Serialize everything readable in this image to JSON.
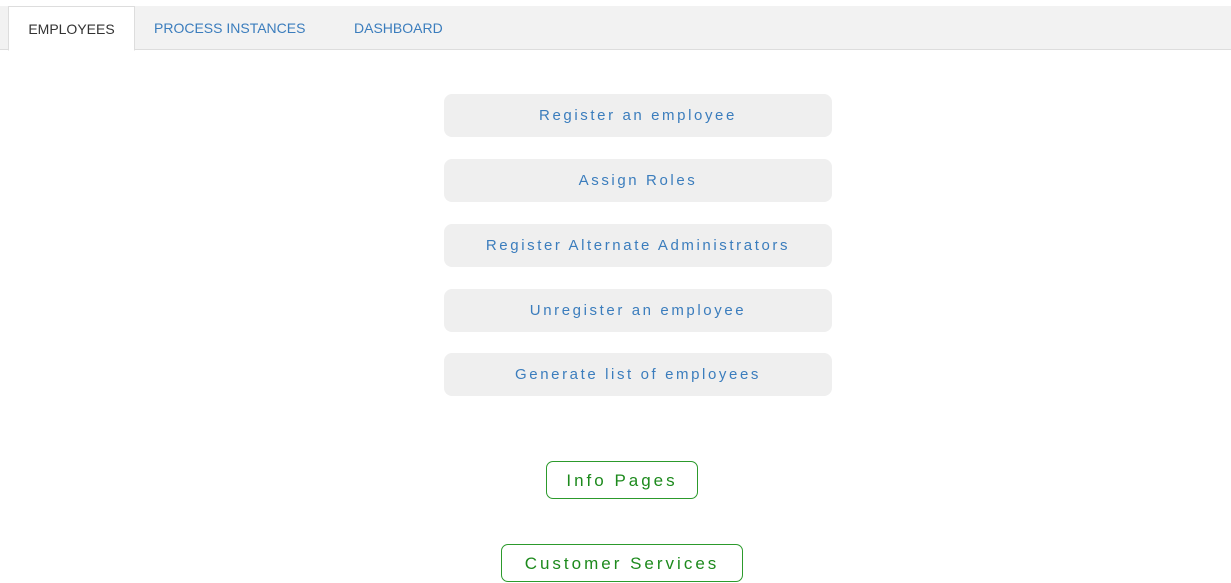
{
  "tabs": [
    {
      "label": "EMPLOYEES",
      "active": true
    },
    {
      "label": "PROCESS INSTANCES",
      "active": false
    },
    {
      "label": "DASHBOARD",
      "active": false
    }
  ],
  "actions": [
    {
      "label": "Register an employee"
    },
    {
      "label": "Assign Roles"
    },
    {
      "label": "Register Alternate Administrators"
    },
    {
      "label": "Unregister an employee"
    },
    {
      "label": "Generate list of employees"
    }
  ],
  "links": {
    "info_pages": "Info Pages",
    "customer_services": "Customer Services"
  },
  "colors": {
    "link_blue": "#3b7dbd",
    "button_bg": "#efefef",
    "green": "#2c9a2c"
  }
}
